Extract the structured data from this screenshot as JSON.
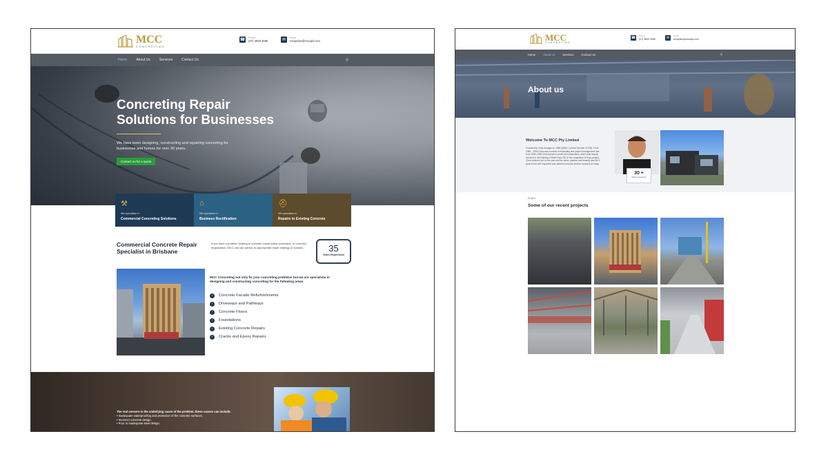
{
  "home": {
    "logo": {
      "main": "MCC",
      "sub": "CONCRETING"
    },
    "header": {
      "phone_label": "Phone",
      "phone_value": "(07) 3839 3065",
      "email_label": "Email",
      "email_value": "reception@mccqld.com"
    },
    "nav": [
      "Home",
      "About Us",
      "Services",
      "Contact Us"
    ],
    "nav_active": "Home",
    "hero": {
      "title": "Concreting Repair Solutions for Businesses",
      "subtitle": "We have been designing, constructing and repairing concreting for businesses and homes for over 30 years.",
      "cta": "Contact us for a quote"
    },
    "services": [
      {
        "pre": "We specialise in",
        "name": "Commercial Concreting Solutions",
        "icon": "excavator-icon",
        "color": "#1f3a55"
      },
      {
        "pre": "We specialise in",
        "name": "Business Rectification",
        "icon": "house-icon",
        "color": "#2b6183"
      },
      {
        "pre": "We specialise in",
        "name": "Repairs to Existing Concrete",
        "icon": "hard-hat-icon",
        "color": "#5c4b2c"
      }
    ],
    "section": {
      "title": "Commercial Concrete Repair Specialist in Brisbane",
      "text": "If you have a problem relating to concrete construction anomalies, or concrete degradation, MCC can can advise an appropriate repair strategy or solution.",
      "exp_number": "35",
      "exp_label": "Years Experience"
    },
    "intro": "MCC Concreting not only fix your concreting problems but we are specialists in designing and constructing concreting for the following areas.",
    "areas": [
      "Concrete Facade Refurbishments",
      "Driveways and Pathways",
      "Concrete Floors",
      "Foundations",
      "Existing Concrete Repairs",
      "Cracks and Epoxy Repairs"
    ],
    "bottom": {
      "lead": "The real concern is the underlying cause of the problem, these causes can include:",
      "items": [
        "Inadequate waterproofing and protection of the concrete surfaces.",
        "Incorrect concrete design.",
        "Poor or inadequate steel design."
      ]
    }
  },
  "about": {
    "logo": {
      "main": "MCC",
      "sub": "CONCRETING"
    },
    "header": {
      "phone_label": "Phone",
      "phone_value": "(07) 3839 3065",
      "email_label": "Email",
      "email_value": "reception@mccqld.com"
    },
    "nav": [
      "Home",
      "About Us",
      "Services",
      "Contact Us"
    ],
    "nav_active": "About Us",
    "hero_title": "About us",
    "welcome_title": "Welcome To MCC Pty Limited",
    "welcome_text": "Founded by Chris Armagno in 1988 (QBCC Licence Number 32708). From 1988 – 1995 Chris was involved in estimating and project management and from 1995–1998 Chris formed a small civil construction, which was heavily involved in the building of World Expo 88. At the completion of Expo project, Chris ventured out on his own and his vision, passion and tenacity saw MCC grow to the well respected and admired concrete service company of today.",
    "exp_number": "30 +",
    "exp_label": "Years experience",
    "projects_pre": "Project",
    "projects_title": "Some of our recent projects"
  },
  "colors": {
    "nav_bg": "#555b63",
    "accent_gold": "#b99a3a",
    "cta_green": "#2a9d3a",
    "dark_blue": "#1f3a55"
  }
}
